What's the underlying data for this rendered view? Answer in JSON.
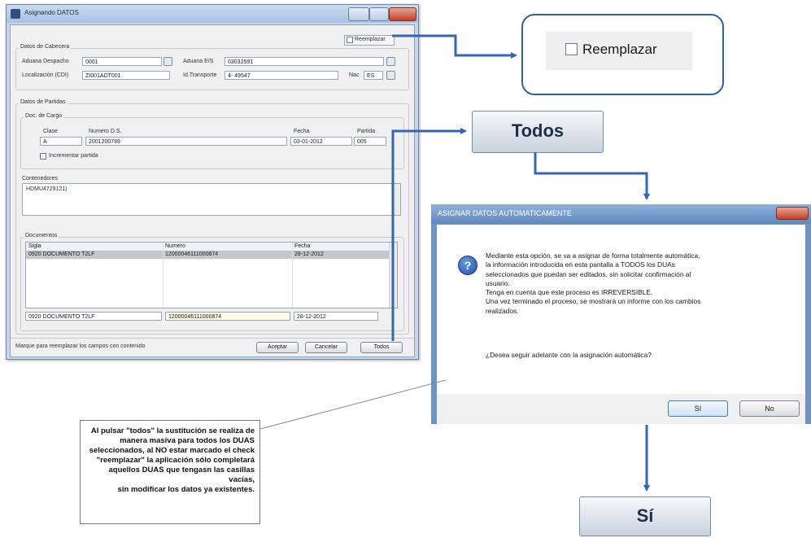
{
  "window": {
    "title": "Asignando DATOS",
    "reemplazar_check": "Reemplazar",
    "cabecera": {
      "group_label": "Datos de Cabecera",
      "aduana_despacho_label": "Aduana Despacho",
      "aduana_despacho_value": "0001",
      "aduana_es_label": "Aduana E/S",
      "aduana_es_value": "03032591",
      "localizacion_label": "Localización (CDI)",
      "localizacion_value": "ZI001ADT001",
      "id_transporte_label": "Id.Transporte",
      "id_transporte_value": "4- 49547",
      "nac_label": "Nac",
      "nac_value": "ES"
    },
    "partidas": {
      "group_label": "Datos de Partidas",
      "doc_cargo_label": "Doc. de Cargo",
      "clase_label": "Clase",
      "clase_value": "A",
      "numero_label": "Numero D.S.",
      "numero_value": "2001200789",
      "fecha_label": "Fecha",
      "fecha_value": "03-01-2012",
      "partida_label": "Partida",
      "partida_value": "005",
      "incrementar_label": "Incrementar partida",
      "contenedores_label": "Contenedores",
      "contenedores_value": "HDMU4729121)",
      "documentos_label": "Documentos",
      "doc_columns": [
        "Sigla",
        "Numero",
        "Fecha"
      ],
      "doc_rows": [
        [
          "0920 DOCUMENTO T2LF",
          "12000046111000874",
          "28-12-2012"
        ]
      ],
      "edit_row": [
        "0920 DOCUMENTO T2LF",
        "12000046111000874",
        "28-12-2012"
      ]
    },
    "status_text": "Marque para reemplazar los campos con contenido",
    "btn_aceptar": "Aceptar",
    "btn_cancelar": "Cancelar",
    "btn_todos": "Todos"
  },
  "callouts": {
    "reemplazar": "Reemplazar",
    "todos": "Todos",
    "si": "Sí"
  },
  "dialog": {
    "title": "ASIGNAR DATOS AUTOMATICAMENTE",
    "message_lines": [
      "Mediante esta opción, se va a asignar de forma totalmente automática,",
      "la información introducida en esta pantalla a TODOS los DUAs",
      "seleccionados que puedan ser editados, sin solicitar confirmación al",
      "usuario.",
      "Tenga en cuenta que este proceso es IRREVERSIBLE.",
      "Una vez terminado el proceso, se mostrará un informe con los cambios",
      "realizados."
    ],
    "question": "¿Desea seguir adelante con la asignación automática?",
    "btn_si": "Sí",
    "btn_no": "No"
  },
  "note_lines": [
    "Al pulsar \"todos\" la sustitución se realiza de",
    "manera masiva para todos los DUAS",
    "seleccionados, al NO estar marcado el check",
    "\"reemplazar\" la aplicación sólo completará",
    "aquellos DUAS que tengasn las casillas vacías,",
    "sin modificar los datos ya existentes."
  ],
  "colors": {
    "arrow": "#3465b8",
    "callout_border": "#2d5fb0",
    "dialog_title": "#6c93c4"
  }
}
